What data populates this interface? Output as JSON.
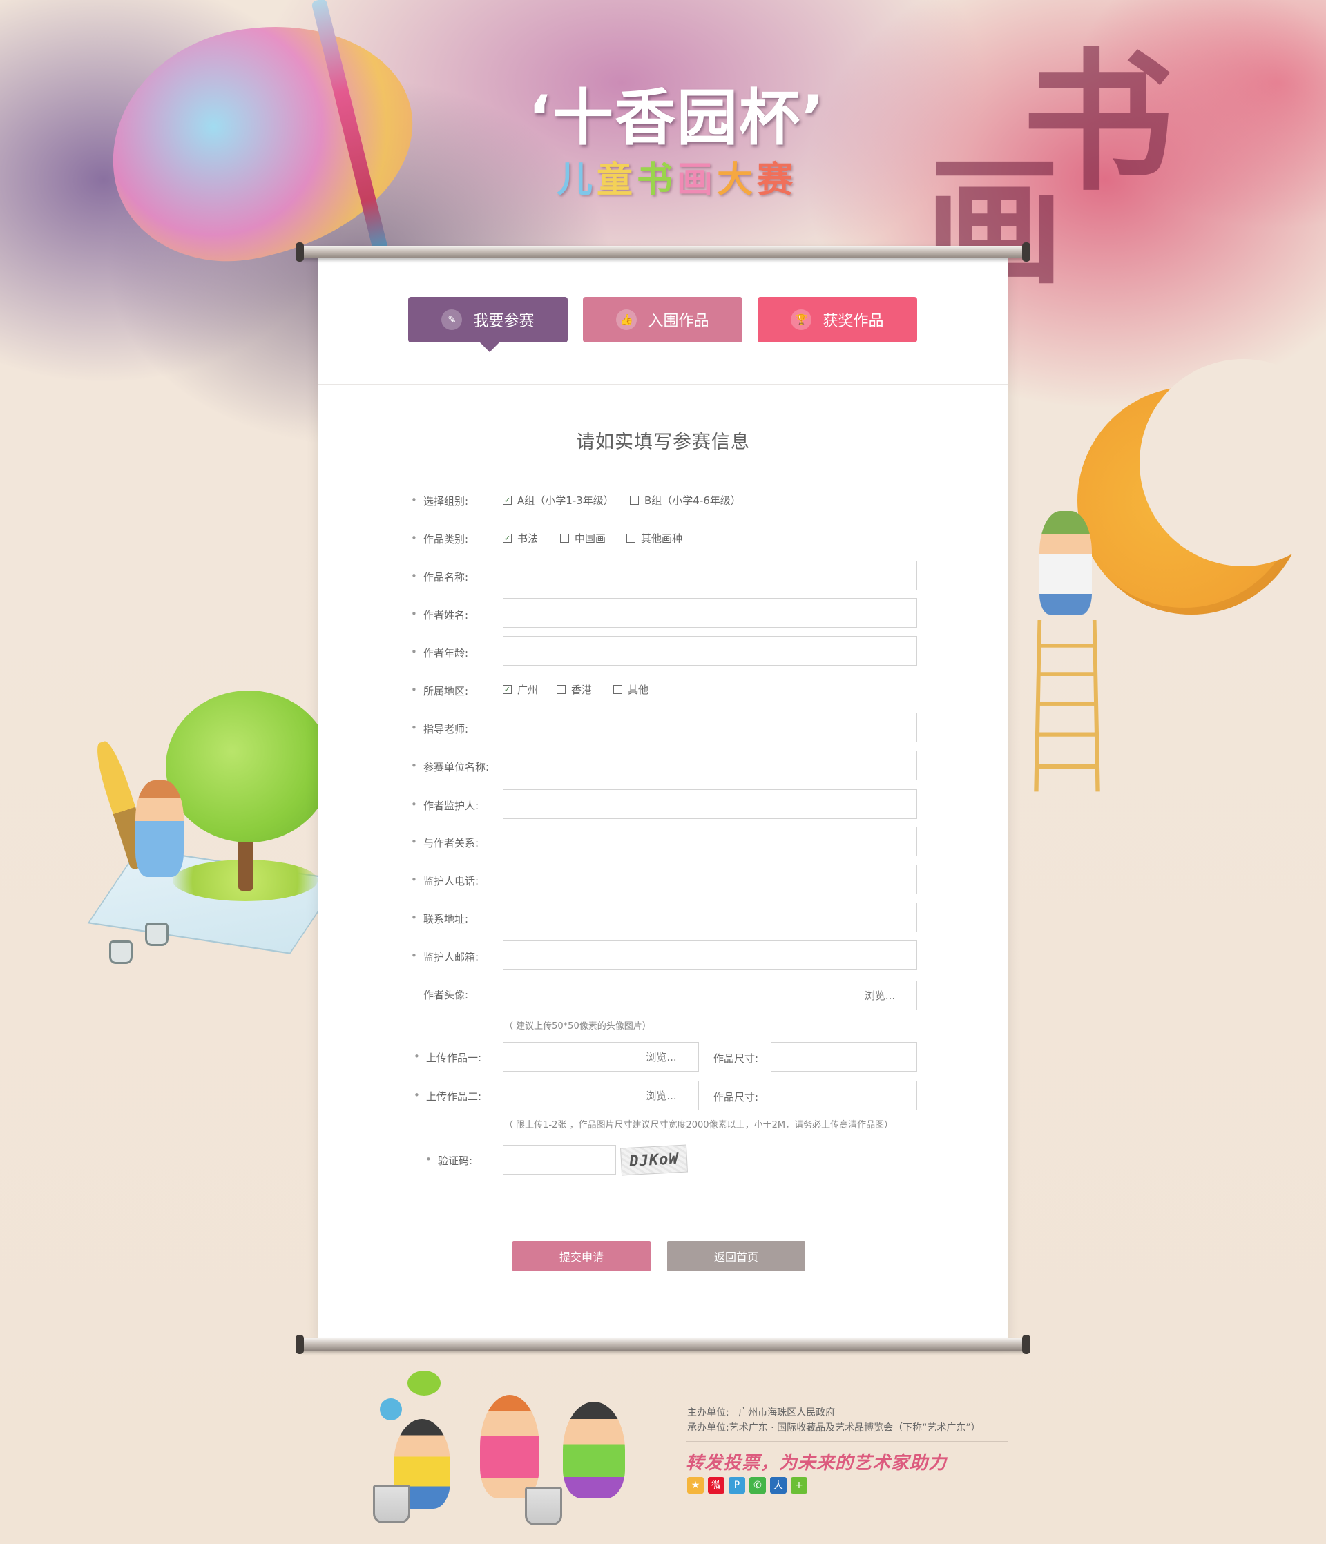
{
  "header": {
    "title": "‘十香园杯’",
    "subtitle_chars": [
      "儿",
      "童",
      "书",
      "画",
      "大",
      "赛"
    ],
    "calligraphy_big": [
      "书",
      "画"
    ]
  },
  "tabs": [
    {
      "label": "我要参赛",
      "icon": "brush-icon",
      "active": true
    },
    {
      "label": "入围作品",
      "icon": "thumbs-up-icon",
      "active": false
    },
    {
      "label": "获奖作品",
      "icon": "trophy-icon",
      "active": false
    }
  ],
  "form": {
    "title": "请如实填写参赛信息",
    "group": {
      "label": "选择组别:",
      "options": [
        {
          "label": "A组（小学1-3年级）",
          "checked": true
        },
        {
          "label": "B组（小学4-6年级）",
          "checked": false
        }
      ]
    },
    "category": {
      "label": "作品类别:",
      "options": [
        {
          "label": "书法",
          "checked": true
        },
        {
          "label": "中国画",
          "checked": false
        },
        {
          "label": "其他画种",
          "checked": false
        }
      ]
    },
    "work_name": {
      "label": "作品名称:",
      "value": ""
    },
    "author_name": {
      "label": "作者姓名:",
      "value": ""
    },
    "author_age": {
      "label": "作者年龄:",
      "value": ""
    },
    "region": {
      "label": "所属地区:",
      "options": [
        {
          "label": "广州",
          "checked": true
        },
        {
          "label": "香港",
          "checked": false
        },
        {
          "label": "其他",
          "checked": false
        }
      ]
    },
    "teacher": {
      "label": "指导老师:",
      "value": ""
    },
    "unit": {
      "label": "参赛单位名称:",
      "value": ""
    },
    "guardian": {
      "label": "作者监护人:",
      "value": ""
    },
    "relation": {
      "label": "与作者关系:",
      "value": ""
    },
    "guardian_phone": {
      "label": "监护人电话:",
      "value": ""
    },
    "address": {
      "label": "联系地址:",
      "value": ""
    },
    "guardian_email": {
      "label": "监护人邮箱:",
      "value": ""
    },
    "avatar": {
      "label": "作者头像:",
      "browse": "浏览...",
      "hint": "（ 建议上传50*50像素的头像图片）"
    },
    "upload1": {
      "label": "上传作品一:",
      "browse": "浏览...",
      "size_label": "作品尺寸:"
    },
    "upload2": {
      "label": "上传作品二:",
      "browse": "浏览...",
      "size_label": "作品尺寸:"
    },
    "upload_hint": "（ 限上传1-2张 ，作品图片尺寸建议尺寸宽度2000像素以上，小于2M，请务必上传高清作品图）",
    "captcha": {
      "label": "验证码:",
      "code": "DJKoW",
      "value": ""
    },
    "submit": "提交申请",
    "back": "返回首页"
  },
  "footer": {
    "host_label": "主办单位:",
    "host": "广州市海珠区人民政府",
    "organizer_label": "承办单位:",
    "organizer": "艺术广东 · 国际收藏品及艺术品博览会（下称“艺术广东”）",
    "slogan": "转发投票，为未来的艺术家助力",
    "share_icons": [
      {
        "name": "qzone-icon",
        "glyph": "★",
        "color": "#f5b53c"
      },
      {
        "name": "weibo-icon",
        "glyph": "微",
        "color": "#e6162d"
      },
      {
        "name": "tencent-weibo-icon",
        "glyph": "P",
        "color": "#3b9fd9"
      },
      {
        "name": "wechat-icon",
        "glyph": "✆",
        "color": "#44b549"
      },
      {
        "name": "renren-icon",
        "glyph": "人",
        "color": "#2a6fbb"
      },
      {
        "name": "more-share-icon",
        "glyph": "+",
        "color": "#6bbf35"
      }
    ]
  }
}
